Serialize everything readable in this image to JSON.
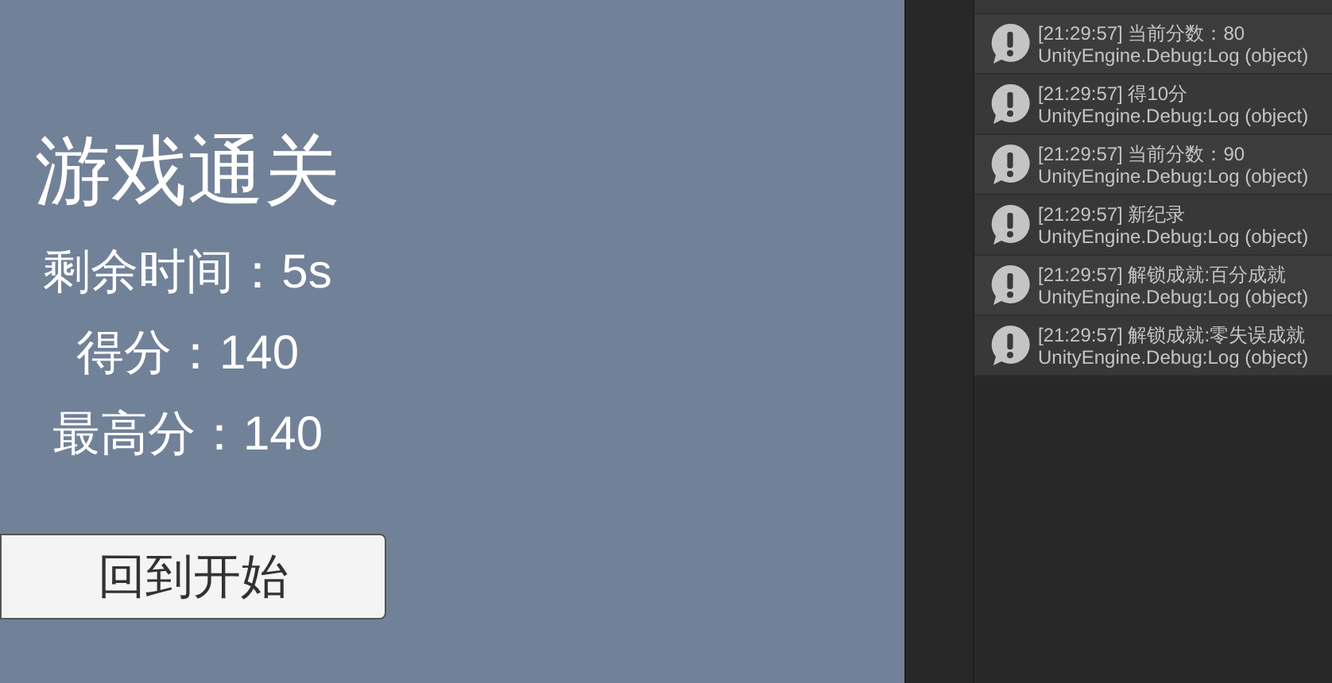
{
  "game": {
    "title": "游戏通关",
    "stats": [
      "剩余时间：5s",
      "得分：140",
      "最高分：140"
    ],
    "button": "回到开始"
  },
  "console": {
    "entries": [
      {
        "message": "[21:29:57] 当前分数：80",
        "source": "UnityEngine.Debug:Log (object)"
      },
      {
        "message": "[21:29:57] 得10分",
        "source": "UnityEngine.Debug:Log (object)"
      },
      {
        "message": "[21:29:57] 当前分数：90",
        "source": "UnityEngine.Debug:Log (object)"
      },
      {
        "message": "[21:29:57] 新纪录",
        "source": "UnityEngine.Debug:Log (object)"
      },
      {
        "message": "[21:29:57] 解锁成就:百分成就",
        "source": "UnityEngine.Debug:Log (object)"
      },
      {
        "message": "[21:29:57] 解锁成就:零失误成就",
        "source": "UnityEngine.Debug:Log (object)"
      }
    ]
  }
}
